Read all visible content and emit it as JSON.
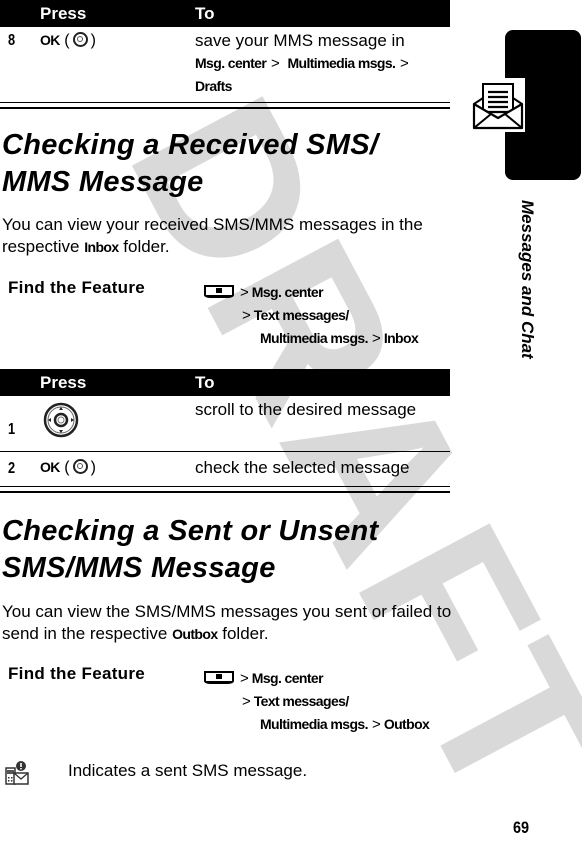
{
  "watermark": "DRAFT",
  "side_tab": {
    "icon": "open-envelope-message-icon",
    "label": "Messages and Chat"
  },
  "table_top": {
    "headers": [
      "Press",
      "To"
    ],
    "rows": [
      {
        "num": "8",
        "press_label": "OK",
        "press_icon": "center-select-key-icon",
        "to_text": "save your MMS message in",
        "to_path": [
          "Msg. center",
          "Multimedia msgs.",
          "Drafts"
        ]
      }
    ]
  },
  "section1": {
    "title_line1": "Checking a Received SMS/",
    "title_line2": "MMS Message",
    "body_pre": "You can view your received SMS/MMS messages in the respective ",
    "body_keyword": "Inbox",
    "body_post": " folder.",
    "find_feature": {
      "label": "Find the Feature",
      "key_icon": "menu-softkey-icon",
      "path": [
        "Msg. center",
        "Text messages/",
        "Multimedia msgs.",
        "Inbox"
      ]
    },
    "table": {
      "headers": [
        "Press",
        "To"
      ],
      "rows": [
        {
          "num": "1",
          "press_icon": "navigation-key-icon",
          "to_text": "scroll to the desired message"
        },
        {
          "num": "2",
          "press_label": "OK",
          "press_icon": "center-select-key-icon",
          "to_text": "check the selected message"
        }
      ]
    }
  },
  "section2": {
    "title_line1": "Checking a Sent or Unsent",
    "title_line2": "SMS/MMS Message",
    "body_pre": "You can view the SMS/MMS messages you sent or failed to send in the respective ",
    "body_keyword": "Outbox",
    "body_post": " folder.",
    "find_feature": {
      "label": "Find the Feature",
      "key_icon": "menu-softkey-icon",
      "path": [
        "Msg. center",
        "Text messages/",
        "Multimedia msgs.",
        "Outbox"
      ]
    },
    "indicator": {
      "icon": "sent-sms-icon",
      "text": "Indicates a sent SMS message."
    }
  },
  "page_number": "69",
  "separator": ">"
}
